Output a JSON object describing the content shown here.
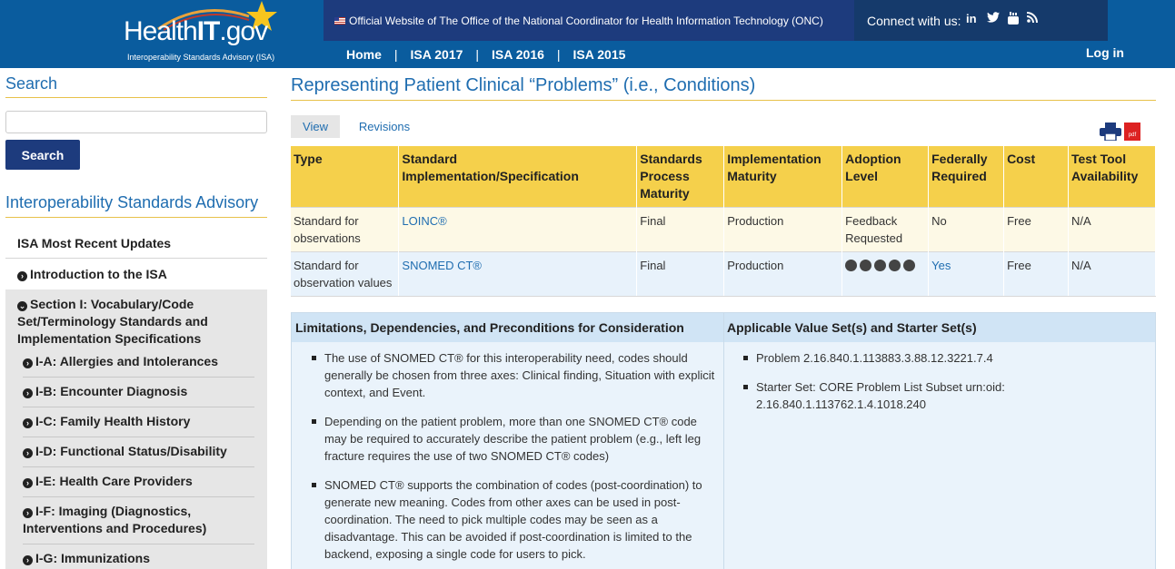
{
  "header": {
    "logo_main": "Health",
    "logo_it": "IT",
    "logo_gov": ".gov",
    "logo_subtitle": "Interoperability Standards Advisory (ISA)",
    "official_text": "Official Website of The Office of the National Coordinator for Health Information Technology (ONC)",
    "connect_label": "Connect with us:",
    "social_icons": [
      "linkedin-icon",
      "twitter-icon",
      "youtube-icon",
      "rss-icon"
    ],
    "nav": [
      "Home",
      "ISA 2017",
      "ISA 2016",
      "ISA 2015"
    ],
    "nav_sep": "|",
    "login": "Log in"
  },
  "sidebar": {
    "search_title": "Search",
    "search_button": "Search",
    "advisory_title": "Interoperability Standards Advisory",
    "items": [
      "ISA Most Recent Updates",
      "Introduction to the ISA",
      "Section I: Vocabulary/Code Set/Terminology Standards and Implementation Specifications"
    ],
    "sub_items": [
      "I-A: Allergies and Intolerances",
      "I-B: Encounter Diagnosis",
      "I-C: Family Health History",
      "I-D: Functional Status/Disability",
      "I-E: Health Care Providers",
      "I-F: Imaging (Diagnostics, Interventions and Procedures)",
      "I-G: Immunizations"
    ]
  },
  "main": {
    "title": "Representing Patient Clinical “Problems” (i.e., Conditions)",
    "tabs": [
      "View",
      "Revisions"
    ],
    "pdf_label": "pdf",
    "table": {
      "headers": [
        "Type",
        "Standard Implementation/Specification",
        "Standards Process Maturity",
        "Implementation Maturity",
        "Adoption Level",
        "Federally Required",
        "Cost",
        "Test Tool Availability"
      ],
      "rows": [
        [
          "Standard for observations",
          "LOINC®",
          "Final",
          "Production",
          "Feedback Requested",
          "No",
          "Free",
          "N/A"
        ],
        [
          "Standard for observation values",
          "SNOMED CT®",
          "Final",
          "Production",
          "",
          "Yes",
          "Free",
          "N/A"
        ]
      ],
      "adoption_dots": 5
    },
    "limitations": {
      "heading_left": "Limitations, Dependencies, and Preconditions for Consideration",
      "heading_right": "Applicable Value Set(s) and Starter Set(s)",
      "left_items": [
        "The use of SNOMED CT® for this interoperability need, codes should generally be chosen from three axes: Clinical finding, Situation with explicit context, and Event.",
        "Depending on the patient problem, more than one SNOMED CT® code may be required to accurately describe the patient problem (e.g., left leg fracture requires the use of two SNOMED CT® codes)",
        "SNOMED CT® supports the combination of codes (post-coordination) to generate new meaning. Codes from other axes can be used in post-coordination. The need to pick multiple codes may be seen as a disadvantage. This can be avoided if post-coordination is limited to the backend, exposing a single code for users to pick."
      ],
      "right_items": [
        "Problem 2.16.840.1.113883.3.88.12.3221.7.4",
        "Starter Set: CORE Problem List Subset urn:oid: 2.16.840.1.113762.1.4.1018.240"
      ]
    }
  },
  "colors": {
    "header_blue": "#0a5c9e",
    "official_bar": "#1d3b7d",
    "accent_gold": "#f5d04b",
    "link_blue": "#1f6db0"
  }
}
